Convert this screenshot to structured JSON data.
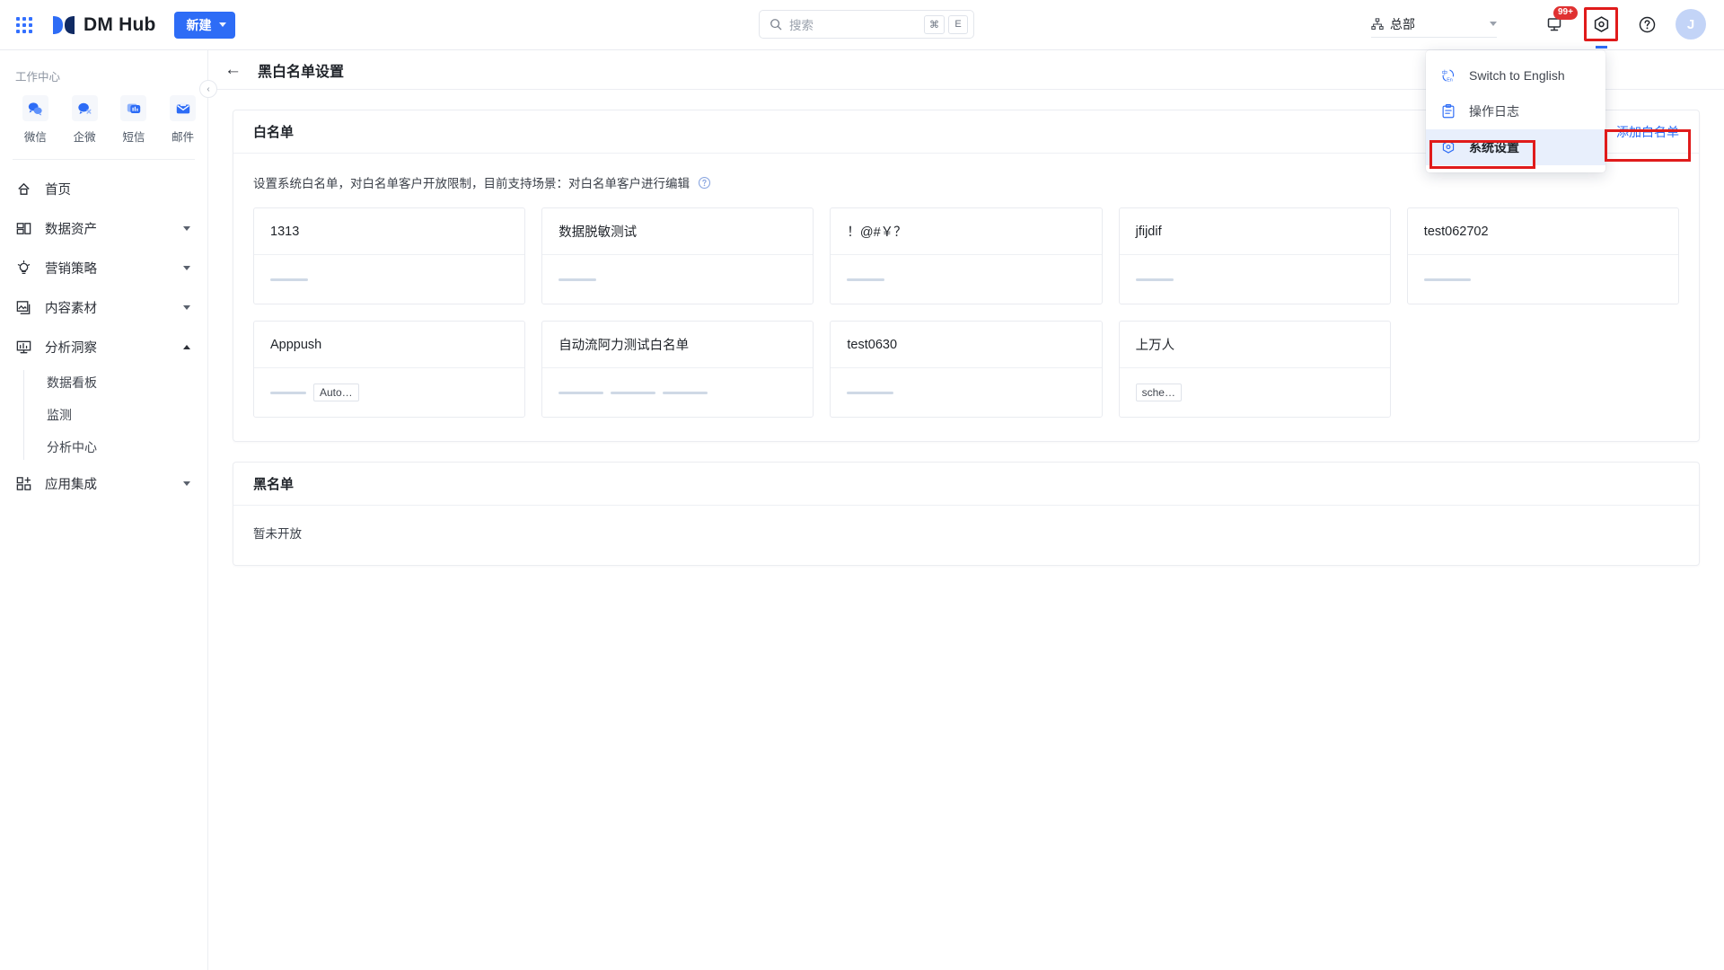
{
  "header": {
    "brand": "DM Hub",
    "new_button": "新建",
    "search_placeholder": "搜索",
    "shortcut_keys": [
      "⌘",
      "E"
    ],
    "org": "总部",
    "notification_badge": "99+",
    "avatar_initial": "J",
    "icons": {
      "apps": "apps-grid-icon",
      "search": "search-icon",
      "org": "org-tree-icon",
      "notification": "notification-icon",
      "settings": "gear-icon",
      "help": "help-circle-icon"
    }
  },
  "settings_menu": {
    "items": [
      {
        "label": "Switch to English",
        "icon": "language-switch-icon",
        "active": false
      },
      {
        "label": "操作日志",
        "icon": "clipboard-log-icon",
        "active": false
      },
      {
        "label": "系统设置",
        "icon": "gear-icon",
        "active": true
      }
    ]
  },
  "sidebar": {
    "section_title": "工作中心",
    "quick_items": [
      {
        "label": "微信",
        "icon": "wechat-icon"
      },
      {
        "label": "企微",
        "icon": "wecom-icon"
      },
      {
        "label": "短信",
        "icon": "sms-icon"
      },
      {
        "label": "邮件",
        "icon": "email-icon"
      }
    ],
    "nav": [
      {
        "label": "首页",
        "icon": "home-icon",
        "expandable": false
      },
      {
        "label": "数据资产",
        "icon": "data-asset-icon",
        "expandable": true,
        "expanded": false
      },
      {
        "label": "营销策略",
        "icon": "strategy-bulb-icon",
        "expandable": true,
        "expanded": false
      },
      {
        "label": "内容素材",
        "icon": "content-image-icon",
        "expandable": true,
        "expanded": false
      },
      {
        "label": "分析洞察",
        "icon": "analytics-monitor-icon",
        "expandable": true,
        "expanded": true,
        "children": [
          "数据看板",
          "监测",
          "分析中心"
        ]
      },
      {
        "label": "应用集成",
        "icon": "app-integration-icon",
        "expandable": true,
        "expanded": false
      }
    ],
    "collapse_icon": "chevron-left-icon"
  },
  "page": {
    "back_icon": "back-arrow-icon",
    "title": "黑白名单设置"
  },
  "whitelist": {
    "card_title": "白名单",
    "add_button": "添加白名单",
    "add_button_icon": "plus-icon",
    "description": "设置系统白名单，对白名单客户开放限制，目前支持场景：对白名单客户进行编辑",
    "help_icon": "question-circle-icon",
    "items": [
      {
        "name": "1313",
        "bars": [
          42
        ],
        "tags": []
      },
      {
        "name": "数据脱敏测试",
        "bars": [
          42
        ],
        "tags": []
      },
      {
        "name": "！@#￥？",
        "bars": [
          42
        ],
        "tags": []
      },
      {
        "name": "jfijdif",
        "bars": [
          42
        ],
        "tags": []
      },
      {
        "name": "test062702",
        "bars": [
          52
        ],
        "tags": []
      },
      {
        "name": "Apppush",
        "bars": [
          40
        ],
        "tags": [
          "Auto…"
        ]
      },
      {
        "name": "自动流阿力测试白名单",
        "bars": [
          50,
          50,
          50
        ],
        "tags": []
      },
      {
        "name": "test0630",
        "bars": [
          52
        ],
        "tags": []
      },
      {
        "name": "上万人",
        "bars": [],
        "tags": [
          "sche…"
        ]
      }
    ]
  },
  "blacklist": {
    "card_title": "黑名单",
    "empty_text": "暂未开放"
  },
  "colors": {
    "accent": "#2d6cf6",
    "highlight_box": "#e01b1b",
    "badge_red": "#e03131",
    "menu_active_bg": "#e8effc",
    "bar_gray": "#cfd9e6"
  }
}
